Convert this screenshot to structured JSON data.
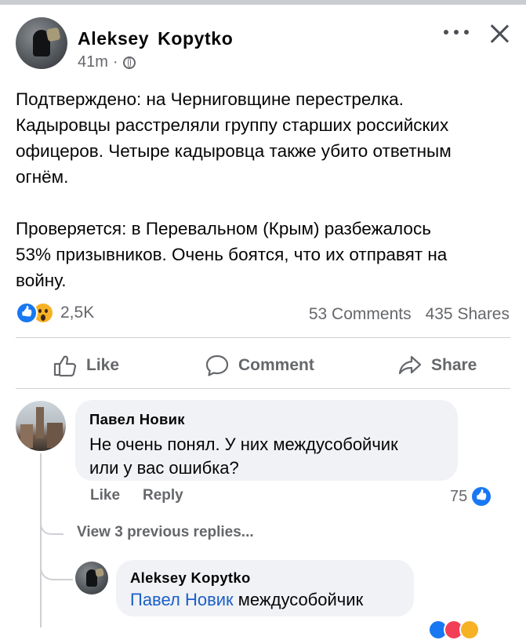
{
  "post": {
    "author": "Aleksey  Kopytko",
    "time": "41m",
    "meta_sep": "·",
    "paragraph1": "Подтверждено: на Черниговщине перестрелка.\nКадыровцы расстреляли группу старших российских\nофицеров. Четыре кадыровца также убито ответным\nогнём.",
    "paragraph2": "Проверяется: в Перевальном (Крым) разбежалось\n53% призывников. Очень боятся, что их отправят на\nвойну.",
    "reaction_count": "2,5K",
    "comments_count": "53 Comments",
    "shares_count": "435 Shares"
  },
  "actions": {
    "like": "Like",
    "comment": "Comment",
    "share": "Share"
  },
  "comment1": {
    "author": "Павел Новик",
    "text": "Не очень понял. У них междусобойчик\nили у вас ошибка?",
    "like_label": "Like",
    "reply_label": "Reply",
    "like_count": "75"
  },
  "view_previous": "View 3 previous replies...",
  "reply1": {
    "author": "Aleksey  Kopytko",
    "mention": "Павел Новик",
    "text": " междусобойчик"
  },
  "colors": {
    "accent": "#1877f2",
    "secondary_text": "#65676b",
    "bubble": "#f0f2f5"
  },
  "icons": [
    "more-icon",
    "close-icon",
    "globe-icon",
    "like-reaction-icon",
    "wow-reaction-icon",
    "like-icon",
    "comment-icon",
    "share-icon"
  ]
}
